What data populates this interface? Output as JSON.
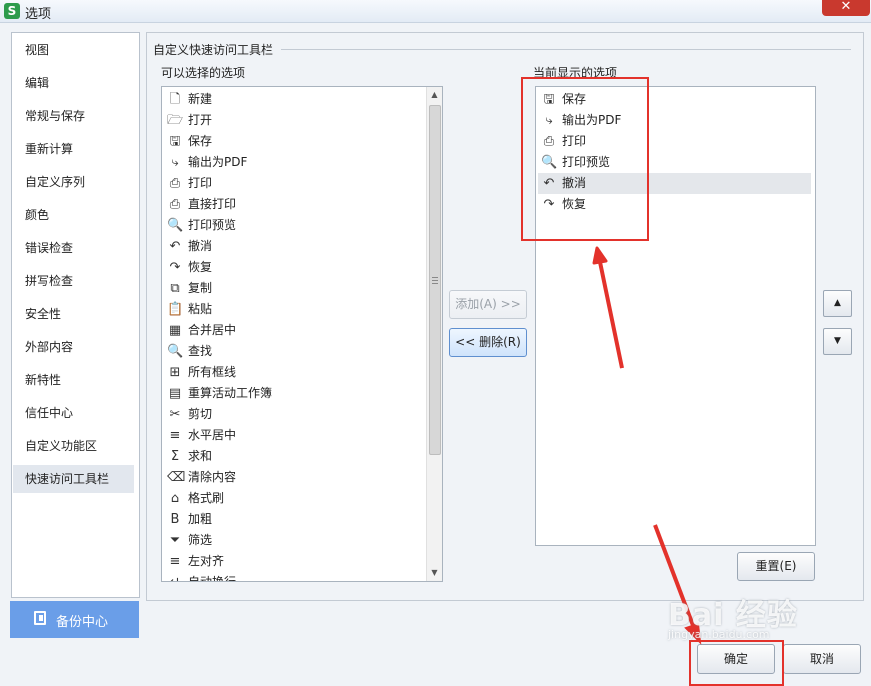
{
  "window": {
    "title": "选项",
    "app_icon": "S",
    "close_glyph": "✕"
  },
  "nav": {
    "items": [
      {
        "label": "视图"
      },
      {
        "label": "编辑"
      },
      {
        "label": "常规与保存"
      },
      {
        "label": "重新计算"
      },
      {
        "label": "自定义序列"
      },
      {
        "label": "颜色"
      },
      {
        "label": "错误检查"
      },
      {
        "label": "拼写检查"
      },
      {
        "label": "安全性"
      },
      {
        "label": "外部内容"
      },
      {
        "label": "新特性"
      },
      {
        "label": "信任中心"
      },
      {
        "label": "自定义功能区"
      },
      {
        "label": "快速访问工具栏",
        "selected": true
      }
    ],
    "backup_label": "备份中心"
  },
  "section": {
    "title": "自定义快速访问工具栏",
    "available_label": "可以选择的选项",
    "current_label": "当前显示的选项"
  },
  "available_items": [
    {
      "label": "新建",
      "icon": "new-document-icon",
      "glyph": "🗋"
    },
    {
      "label": "打开",
      "icon": "open-folder-icon",
      "glyph": "🗁"
    },
    {
      "label": "保存",
      "icon": "save-icon",
      "glyph": "🖫"
    },
    {
      "label": "输出为PDF",
      "icon": "export-pdf-icon",
      "glyph": "⤷"
    },
    {
      "label": "打印",
      "icon": "print-icon",
      "glyph": "⎙"
    },
    {
      "label": "直接打印",
      "icon": "direct-print-icon",
      "glyph": "⎙"
    },
    {
      "label": "打印预览",
      "icon": "print-preview-icon",
      "glyph": "🔍"
    },
    {
      "label": "撤消",
      "icon": "undo-icon",
      "glyph": "↶"
    },
    {
      "label": "恢复",
      "icon": "redo-icon",
      "glyph": "↷"
    },
    {
      "label": "复制",
      "icon": "copy-icon",
      "glyph": "⧉"
    },
    {
      "label": "粘贴",
      "icon": "paste-icon",
      "glyph": "📋"
    },
    {
      "label": "合并居中",
      "icon": "merge-center-icon",
      "glyph": "▦"
    },
    {
      "label": "查找",
      "icon": "find-icon",
      "glyph": "🔍"
    },
    {
      "label": "所有框线",
      "icon": "all-borders-icon",
      "glyph": "⊞"
    },
    {
      "label": "重算活动工作簿",
      "icon": "recalculate-icon",
      "glyph": "▤"
    },
    {
      "label": "剪切",
      "icon": "cut-icon",
      "glyph": "✂"
    },
    {
      "label": "水平居中",
      "icon": "center-align-icon",
      "glyph": "≡"
    },
    {
      "label": "求和",
      "icon": "sum-icon",
      "glyph": "Σ"
    },
    {
      "label": "清除内容",
      "icon": "clear-content-icon",
      "glyph": "⌫"
    },
    {
      "label": "格式刷",
      "icon": "format-painter-icon",
      "glyph": "⌂"
    },
    {
      "label": "加粗",
      "icon": "bold-icon",
      "glyph": "B"
    },
    {
      "label": "筛选",
      "icon": "filter-icon",
      "glyph": "⏷"
    },
    {
      "label": "左对齐",
      "icon": "align-left-icon",
      "glyph": "≡"
    },
    {
      "label": "自动换行",
      "icon": "wrap-text-icon",
      "glyph": "↵"
    }
  ],
  "current_items": [
    {
      "label": "保存",
      "icon": "save-icon",
      "glyph": "🖫"
    },
    {
      "label": "输出为PDF",
      "icon": "export-pdf-icon",
      "glyph": "⤷"
    },
    {
      "label": "打印",
      "icon": "print-icon",
      "glyph": "⎙"
    },
    {
      "label": "打印预览",
      "icon": "print-preview-icon",
      "glyph": "🔍"
    },
    {
      "label": "撤消",
      "icon": "undo-icon",
      "glyph": "↶",
      "selected": true
    },
    {
      "label": "恢复",
      "icon": "redo-icon",
      "glyph": "↷"
    }
  ],
  "buttons": {
    "add": "添加(A) >>",
    "remove": "<< 删除(R)",
    "move_up": "▲",
    "move_down": "▼",
    "reset": "重置(E)",
    "ok": "确定",
    "cancel": "取消"
  },
  "watermark": {
    "main": "Bai 经验",
    "sub": "jingyan.baidu.com"
  },
  "colors": {
    "annotation": "#e3322b",
    "backup_button": "#6a9ee8",
    "close_button": "#c9392e"
  }
}
